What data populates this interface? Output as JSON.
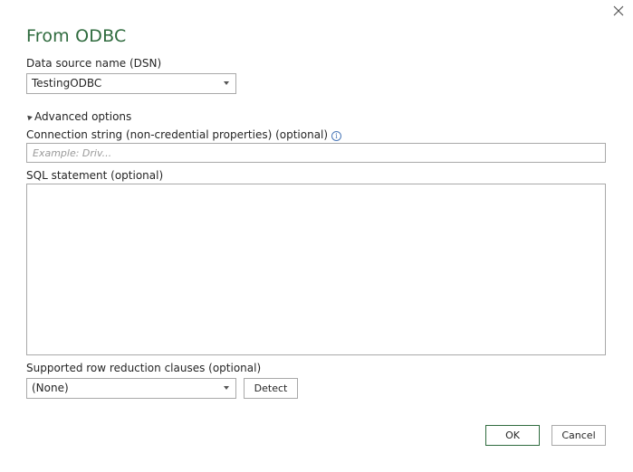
{
  "dialog": {
    "title": "From ODBC"
  },
  "dsn": {
    "label": "Data source name (DSN)",
    "selected": "TestingODBC"
  },
  "advanced": {
    "toggle_label": "Advanced options"
  },
  "connection_string": {
    "label": "Connection string (non-credential properties) (optional)",
    "placeholder": "Example: Driv...",
    "value": ""
  },
  "sql": {
    "label": "SQL statement (optional)",
    "value": ""
  },
  "row_reduction": {
    "label": "Supported row reduction clauses (optional)",
    "selected": "(None)",
    "detect_label": "Detect"
  },
  "footer": {
    "ok_label": "OK",
    "cancel_label": "Cancel"
  },
  "colors": {
    "title": "#2f6b3e",
    "primary_border": "#2f6b3e",
    "info_icon": "#4a78b8",
    "border": "#a8a8a8"
  },
  "icons": {
    "close": "close-icon",
    "dropdown": "chevron-down-icon",
    "info": "info-icon",
    "expander": "triangle-icon"
  }
}
